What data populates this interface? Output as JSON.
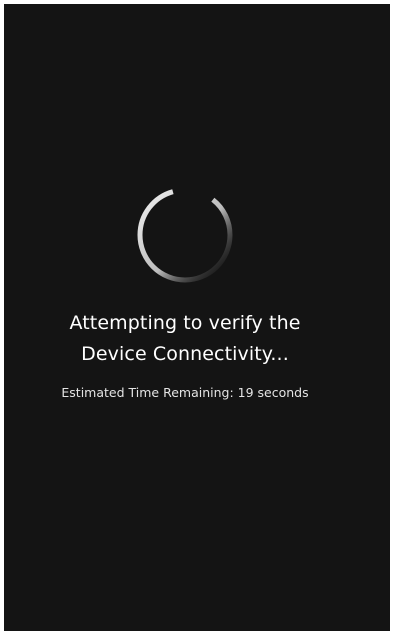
{
  "loading_screen": {
    "title_line1": "Attempting to verify the",
    "title_line2": "Device Connectivity...",
    "eta_text": "Estimated Time Remaining: 19 seconds"
  },
  "spinner": {
    "icon": "loading-spinner-icon"
  },
  "colors": {
    "background": "#141414",
    "text": "#ffffff",
    "spinner_light": "#f2f2f2",
    "spinner_dark": "#141414"
  }
}
